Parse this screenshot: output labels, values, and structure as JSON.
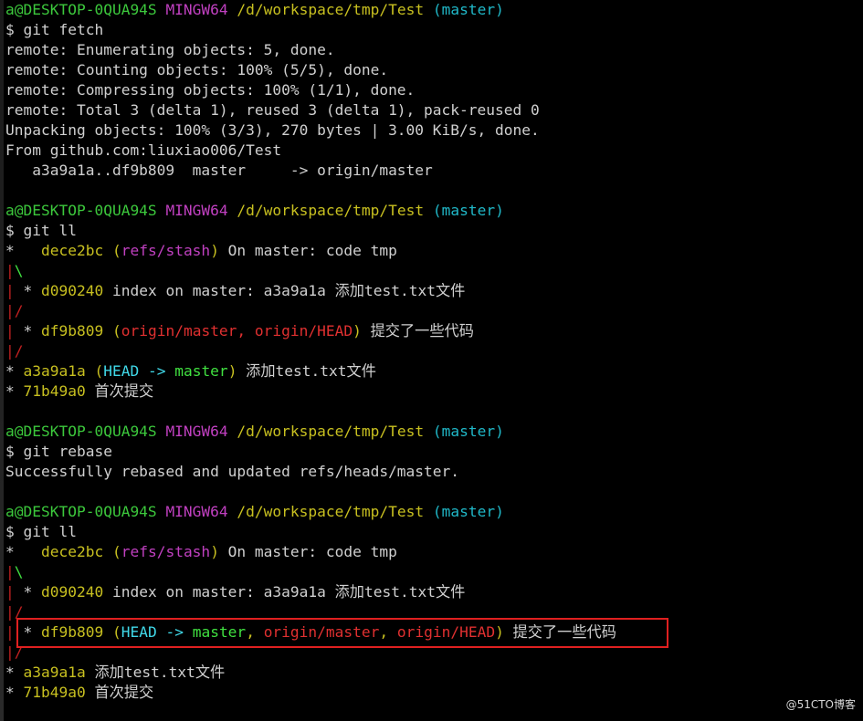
{
  "prompt": {
    "user_host": "a@DESKTOP-0QUA94S",
    "shell": "MINGW64",
    "path": "/d/workspace/tmp/Test",
    "branch": "(master)",
    "dollar": "$ "
  },
  "block1": {
    "command": "git fetch",
    "output": [
      "remote: Enumerating objects: 5, done.",
      "remote: Counting objects: 100% (5/5), done.",
      "remote: Compressing objects: 100% (1/1), done.",
      "remote: Total 3 (delta 1), reused 3 (delta 1), pack-reused 0",
      "Unpacking objects: 100% (3/3), 270 bytes | 3.00 KiB/s, done.",
      "From github.com:liuxiao006/Test",
      "   a3a9a1a..df9b809  master     -> origin/master"
    ]
  },
  "block2": {
    "command": "git ll",
    "stash_hash": "dece2bc",
    "stash_ref": "refs/stash",
    "stash_msg": " On master: code tmp",
    "index_hash": "d090240",
    "index_msg": " index on master: a3a9a1a 添加test.txt文件",
    "df_hash": "df9b809",
    "df_refs": "origin/master, origin/HEAD",
    "df_msg": " 提交了一些代码",
    "a3_hash": "a3a9a1a",
    "a3_head": "HEAD -> ",
    "a3_master": "master",
    "a3_msg": " 添加test.txt文件",
    "first_hash": "71b49a0",
    "first_msg": " 首次提交"
  },
  "block3": {
    "command": "git rebase",
    "output": "Successfully rebased and updated refs/heads/master."
  },
  "block4": {
    "command": "git ll",
    "stash_hash": "dece2bc",
    "stash_ref": "refs/stash",
    "stash_msg": " On master: code tmp",
    "index_hash": "d090240",
    "index_msg": " index on master: a3a9a1a 添加test.txt文件",
    "df_hash": "df9b809",
    "df_head": "HEAD -> ",
    "df_master": "master",
    "df_origin_master": "origin/master",
    "df_origin_head": "origin/HEAD",
    "df_msg": " 提交了一些代码",
    "a3_hash": "a3a9a1a",
    "a3_msg": " 添加test.txt文件",
    "first_hash": "71b49a0",
    "first_msg": " 首次提交"
  },
  "watermark": "@51CTO博客",
  "colors": {
    "prompt_user": "#3cc83c",
    "prompt_shell": "#c040c0",
    "prompt_path": "#c8c020",
    "prompt_branch": "#20b8c8",
    "highlight_border": "#e02020"
  }
}
